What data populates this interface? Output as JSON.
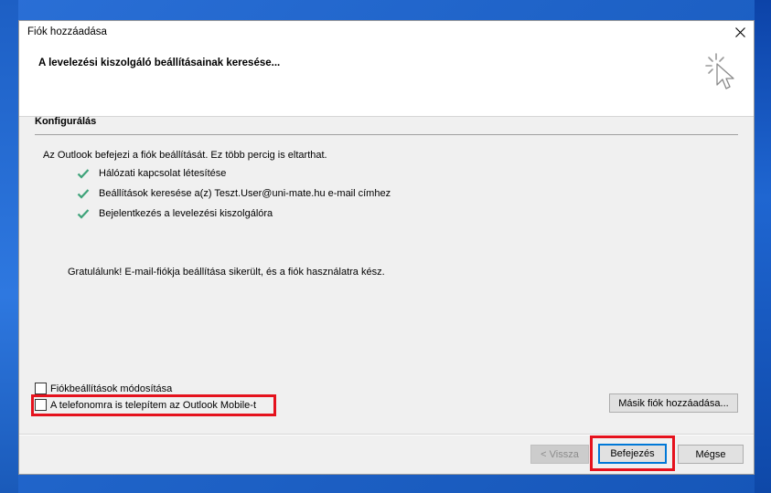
{
  "window": {
    "title": "Fiók hozzáadása",
    "header_title": "A levelezési kiszolgáló beállításainak keresése..."
  },
  "config": {
    "section_title": "Konfigurálás",
    "intro": "Az Outlook befejezi a fiók beállítását. Ez több percig is eltarthat.",
    "steps": [
      "Hálózati kapcsolat létesítése",
      "Beállítások keresése a(z) Teszt.User@uni-mate.hu e-mail címhez",
      "Bejelentkezés a levelezési kiszolgálóra"
    ],
    "congrats": "Gratulálunk! E-mail-fiókja beállítása sikerült, és a fiók használatra kész."
  },
  "options": {
    "modify_settings": "Fiókbeállítások módosítása",
    "install_mobile": "A telefonomra is telepítem az Outlook Mobile-t"
  },
  "buttons": {
    "add_another": "Másik fiók hozzáadása...",
    "back": "< Vissza",
    "finish": "Befejezés",
    "cancel": "Mégse"
  },
  "colors": {
    "check": "#3fa37a",
    "highlight": "#e5121d",
    "focus": "#0078d7"
  }
}
